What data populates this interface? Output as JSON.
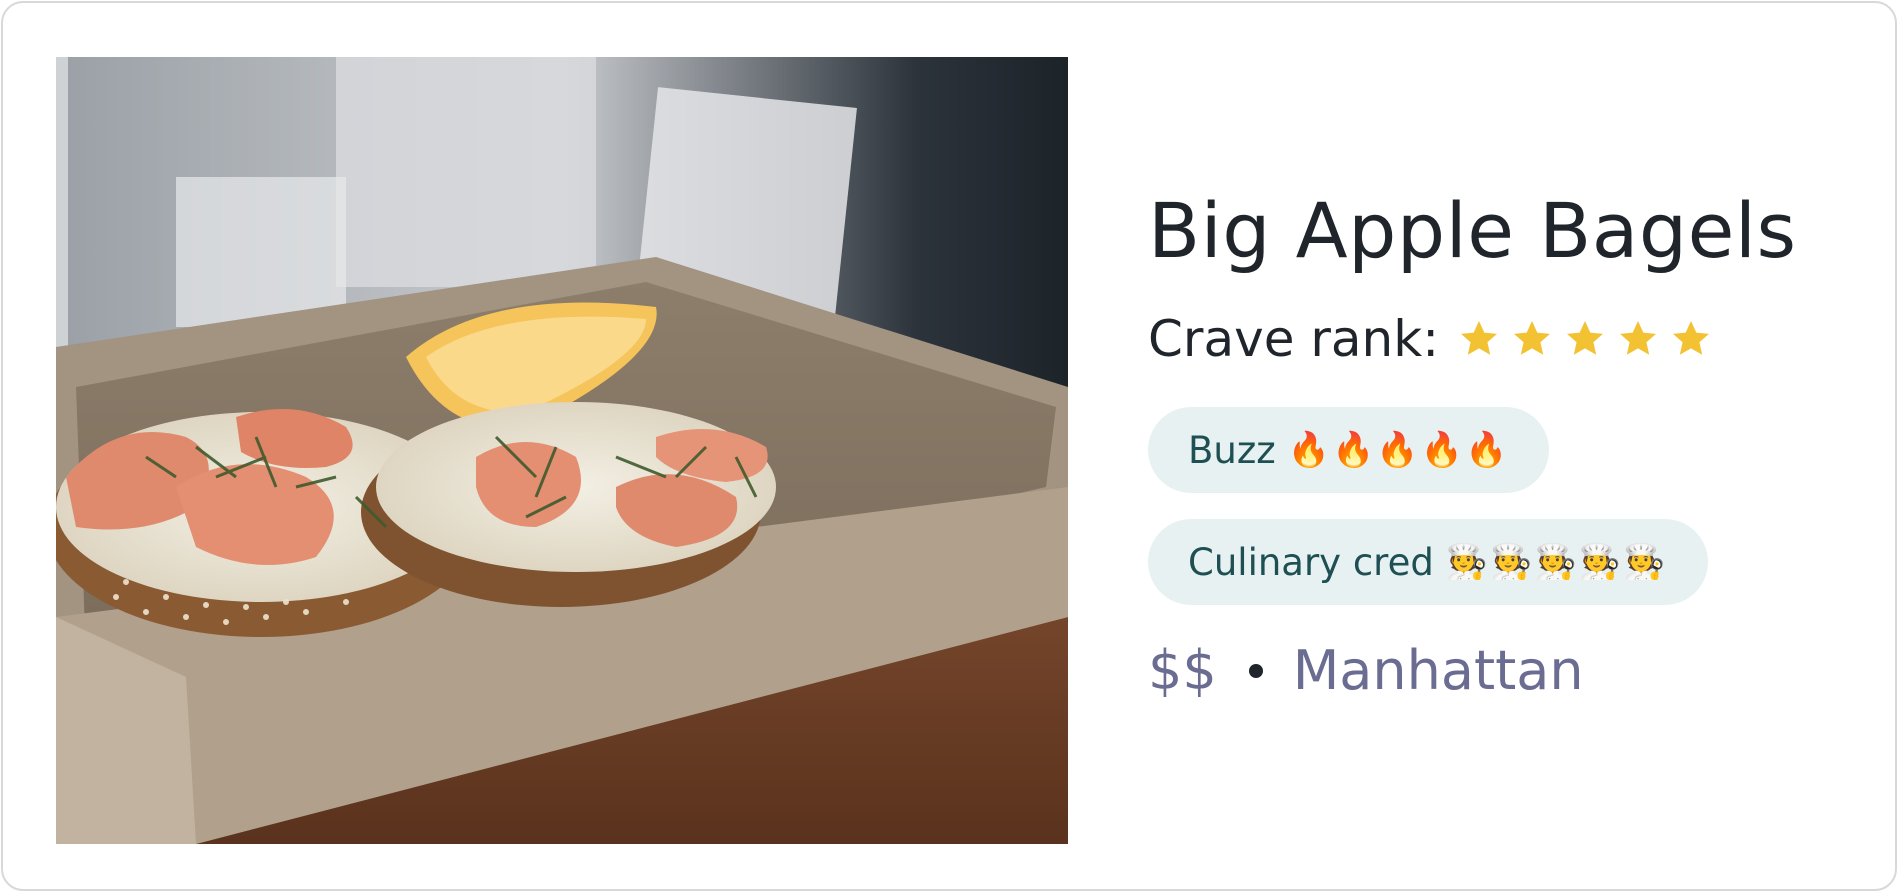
{
  "restaurant": {
    "name": "Big Apple Bagels",
    "photo_description_icon": "bagel-photo",
    "crave_rank": {
      "label": "Crave rank:",
      "rating": 5,
      "max": 5,
      "star_color": "#f2c233"
    },
    "buzz": {
      "label": "Buzz",
      "icons": "🔥🔥🔥🔥🔥",
      "level": 5
    },
    "culinary_cred": {
      "label": "Culinary cred",
      "icons": "🧑‍🍳🧑‍🍳🧑‍🍳🧑‍🍳🧑‍🍳",
      "level": 5
    },
    "price": "$$",
    "neighborhood": "Manhattan"
  },
  "colors": {
    "title": "#1f252b",
    "pill_bg": "#e8f1f2",
    "pill_text": "#1e4f52",
    "meta_text": "#6a6d91",
    "star": "#f2c233"
  }
}
